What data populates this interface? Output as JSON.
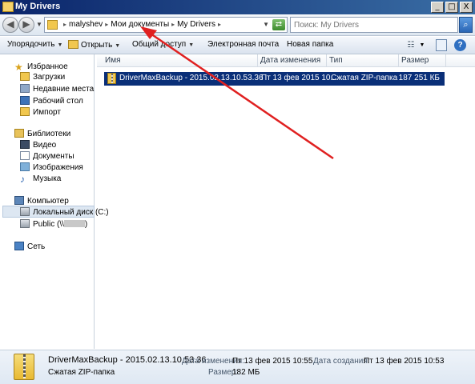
{
  "window": {
    "title": "My Drivers",
    "minimize": "_",
    "maximize": "□",
    "close": "X"
  },
  "address": {
    "crumbs": [
      "malyshev",
      "Мои документы",
      "My Drivers"
    ],
    "refresh_icon": "refresh-arrow-icon",
    "search_placeholder": "Поиск: My Drivers"
  },
  "toolbar": {
    "organize": "Упорядочить",
    "open": "Открыть",
    "share": "Общий доступ",
    "email": "Электронная почта",
    "new_folder": "Новая папка"
  },
  "sidebar": {
    "favorites": "Избранное",
    "downloads": "Загрузки",
    "recent": "Недавние места",
    "desktop": "Рабочий стол",
    "import": "Импорт",
    "libraries": "Библиотеки",
    "video": "Видео",
    "documents": "Документы",
    "images": "Изображения",
    "music": "Музыка",
    "computer": "Компьютер",
    "local_disk": "Локальный диск (C:)",
    "public": "Public (\\\\",
    "public_suffix": ")",
    "network": "Сеть"
  },
  "columns": {
    "name": "Имя",
    "modified": "Дата изменения",
    "type": "Тип",
    "size": "Размер"
  },
  "files": [
    {
      "name": "DriverMaxBackup - 2015.02.13.10.53.36",
      "modified": "Пт 13 фев 2015 10...",
      "type": "Сжатая ZIP-папка",
      "size": "187 251 КБ"
    }
  ],
  "details": {
    "name": "DriverMaxBackup - 2015.02.13.10.53.36",
    "type": "Сжатая ZIP-папка",
    "modified_label": "Дата изменения:",
    "modified_value": "Пт 13 фев 2015 10:55",
    "size_label": "Размер:",
    "size_value": "182 МБ",
    "created_label": "Дата создания:",
    "created_value": "Пт 13 фев 2015 10:53"
  },
  "colors": {
    "annotation_arrow": "#e02020",
    "selection": "#0a2f78"
  }
}
